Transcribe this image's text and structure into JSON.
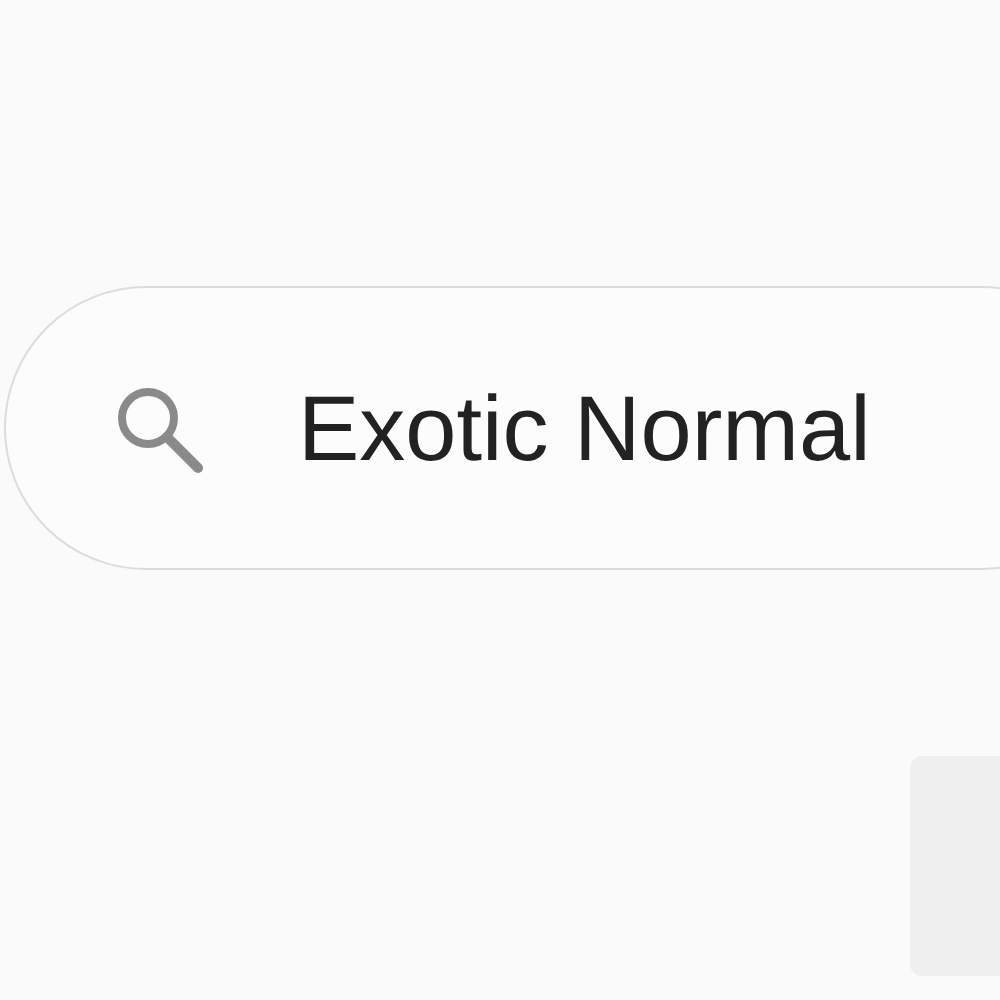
{
  "search": {
    "value": "Exotic Normal"
  },
  "panel": {
    "kind": "card"
  }
}
